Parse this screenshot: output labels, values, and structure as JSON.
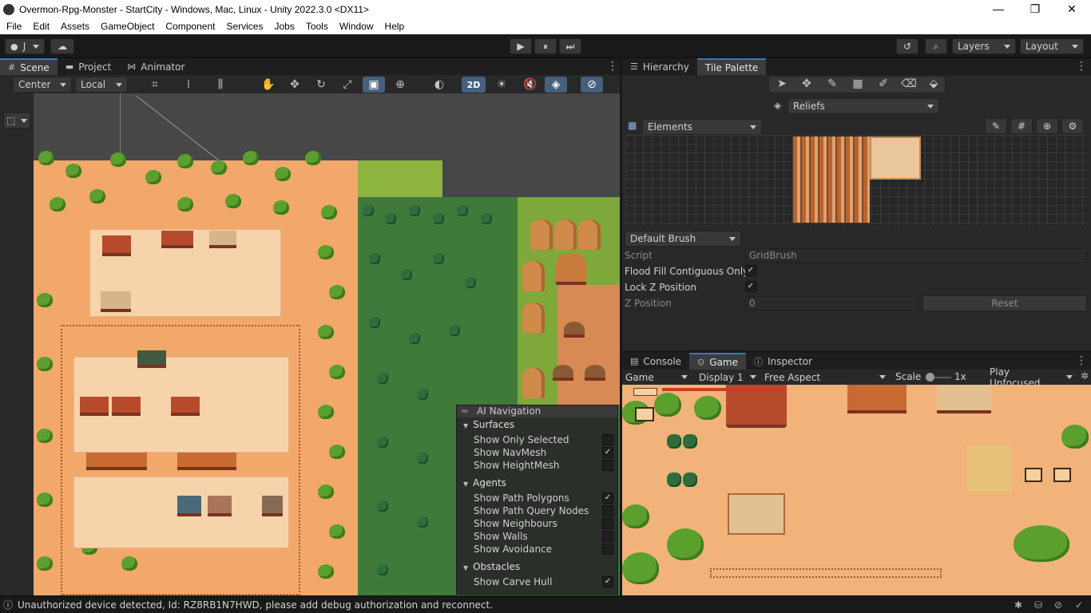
{
  "window": {
    "title": "Overmon-Rpg-Monster - StartCity - Windows, Mac, Linux - Unity 2022.3.0 <DX11>",
    "minimize": "—",
    "restore": "❐",
    "close": "✕"
  },
  "menu": [
    "File",
    "Edit",
    "Assets",
    "GameObject",
    "Component",
    "Services",
    "Jobs",
    "Tools",
    "Window",
    "Help"
  ],
  "toolbar": {
    "account": "J",
    "play": "▶",
    "pause": "⏸",
    "step": "⏭",
    "layers": "Layers",
    "layout": "Layout"
  },
  "scene_panel": {
    "tabs": [
      "Scene",
      "Project",
      "Animator"
    ],
    "pivot": "Center",
    "space": "Local",
    "mode_2d": "2D"
  },
  "ai_navigation": {
    "title": "AI Navigation",
    "sections": {
      "surfaces": "Surfaces",
      "agents": "Agents",
      "obstacles": "Obstacles"
    },
    "options": [
      {
        "label": "Show Only Selected",
        "checked": false
      },
      {
        "label": "Show NavMesh",
        "checked": true
      },
      {
        "label": "Show HeightMesh",
        "checked": false
      },
      {
        "label": "Show Path Polygons",
        "checked": true
      },
      {
        "label": "Show Path Query Nodes",
        "checked": false
      },
      {
        "label": "Show Neighbours",
        "checked": false
      },
      {
        "label": "Show Walls",
        "checked": false
      },
      {
        "label": "Show Avoidance",
        "checked": false
      },
      {
        "label": "Show Carve Hull",
        "checked": true
      }
    ]
  },
  "right_top": {
    "tabs": [
      "Hierarchy",
      "Tile Palette"
    ],
    "active_tab": "Tile Palette",
    "palette": "Reliefs",
    "layer": "Elements",
    "brush": "Default Brush",
    "script_label": "Script",
    "script_value": "GridBrush",
    "flood_fill_label": "Flood Fill Contiguous Only",
    "lock_z_label": "Lock Z Position",
    "z_position_label": "Z Position",
    "z_position_value": "0",
    "reset": "Reset"
  },
  "right_bottom": {
    "tabs": [
      "Console",
      "Game",
      "Inspector"
    ],
    "active_tab": "Game",
    "view": "Game",
    "display": "Display 1",
    "aspect": "Free Aspect",
    "scale_label": "Scale",
    "scale_value": "1x",
    "play_mode": "Play Unfocused"
  },
  "status": {
    "message": "Unauthorized device detected, Id: RZ8RB1N7HWD, please add debug authorization and reconnect."
  },
  "colors": {
    "accent": "#3a79bb",
    "sand": "#f2a86a",
    "grass": "#7fa83a"
  }
}
